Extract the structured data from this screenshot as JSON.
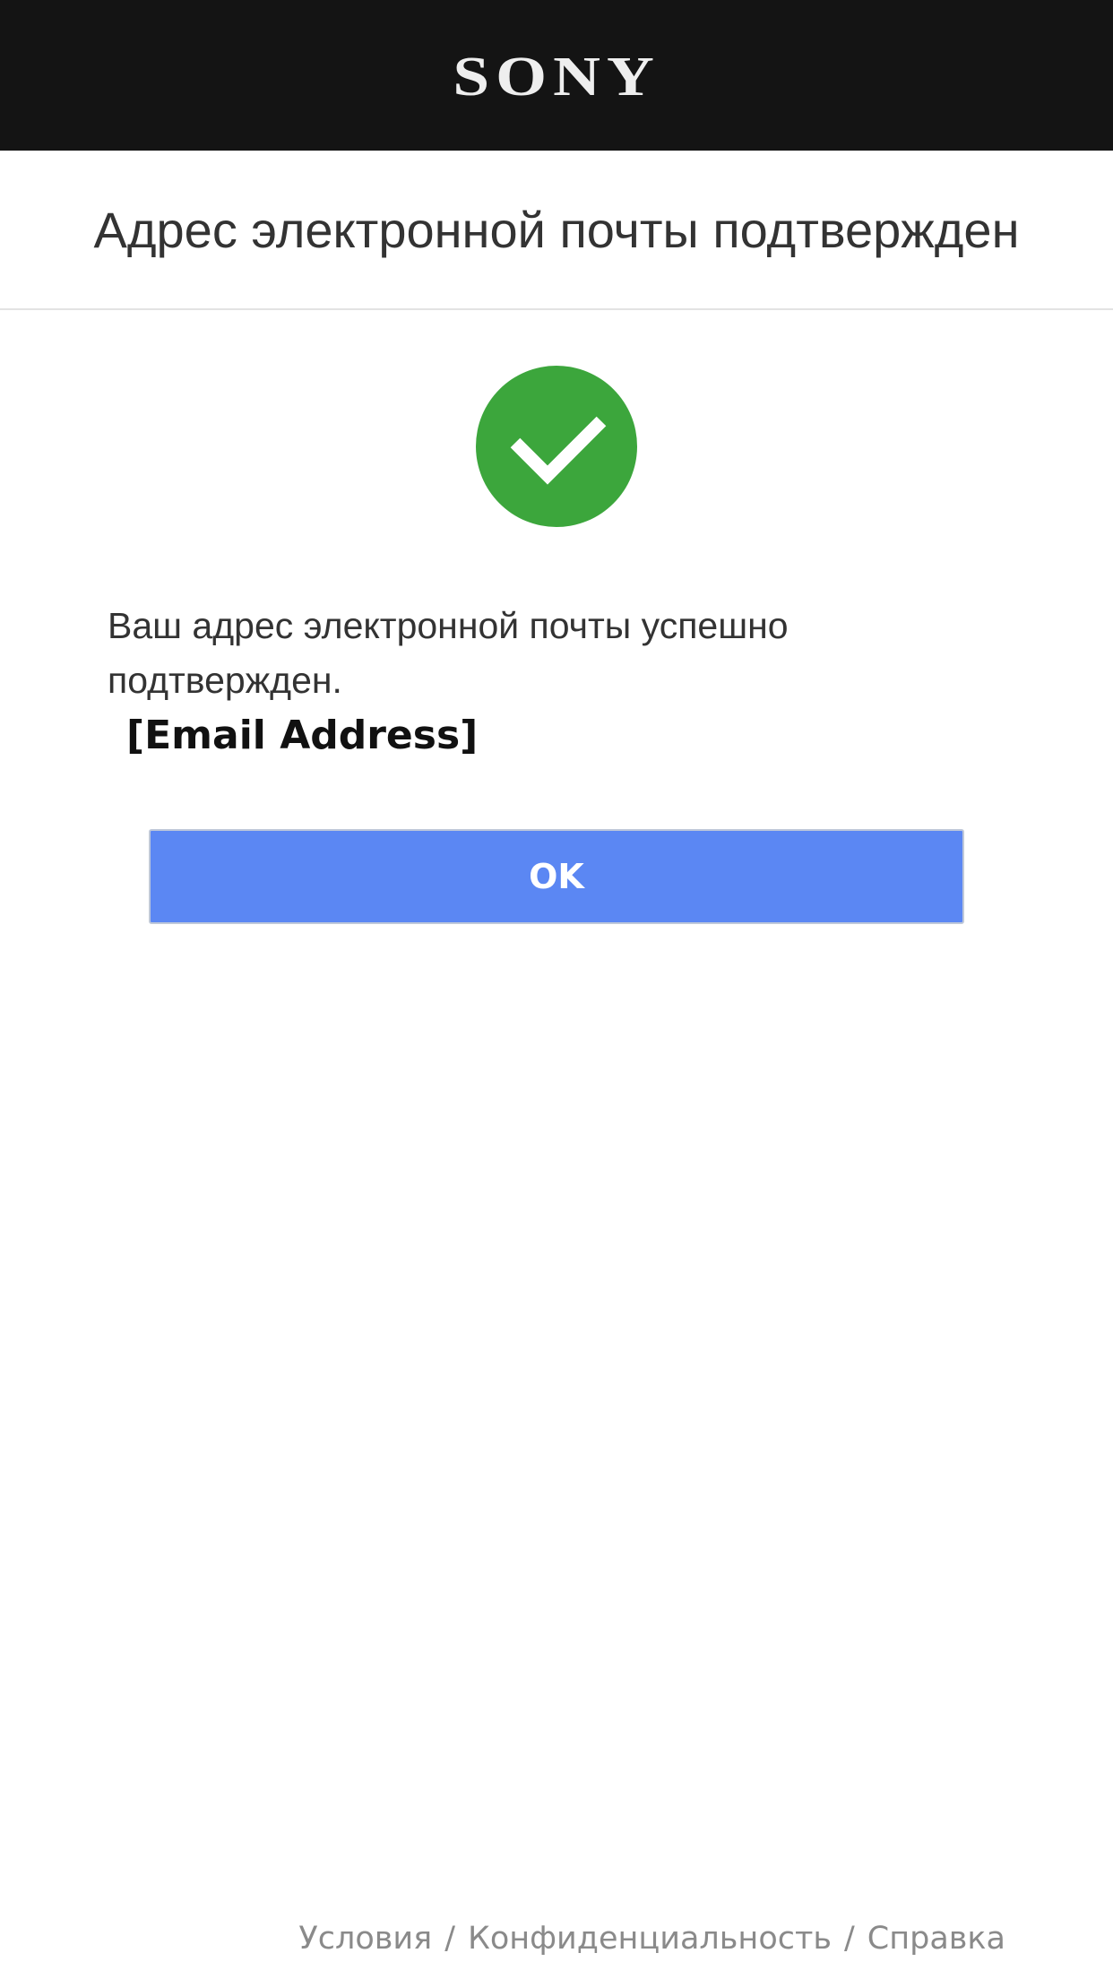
{
  "header": {
    "brand": "SONY"
  },
  "page": {
    "title": "Адрес электронной почты подтвержден"
  },
  "status": {
    "icon": "check-circle-icon",
    "color": "#3ca63c"
  },
  "message": {
    "text": "Ваш адрес электронной почты успешно подтвержден.",
    "email": "[Email Address]"
  },
  "actions": {
    "ok_label": "OK",
    "ok_color": "#5b87f3"
  },
  "footer": {
    "links": [
      "Условия",
      "Конфиденциальность",
      "Справка"
    ],
    "separator": "/"
  }
}
